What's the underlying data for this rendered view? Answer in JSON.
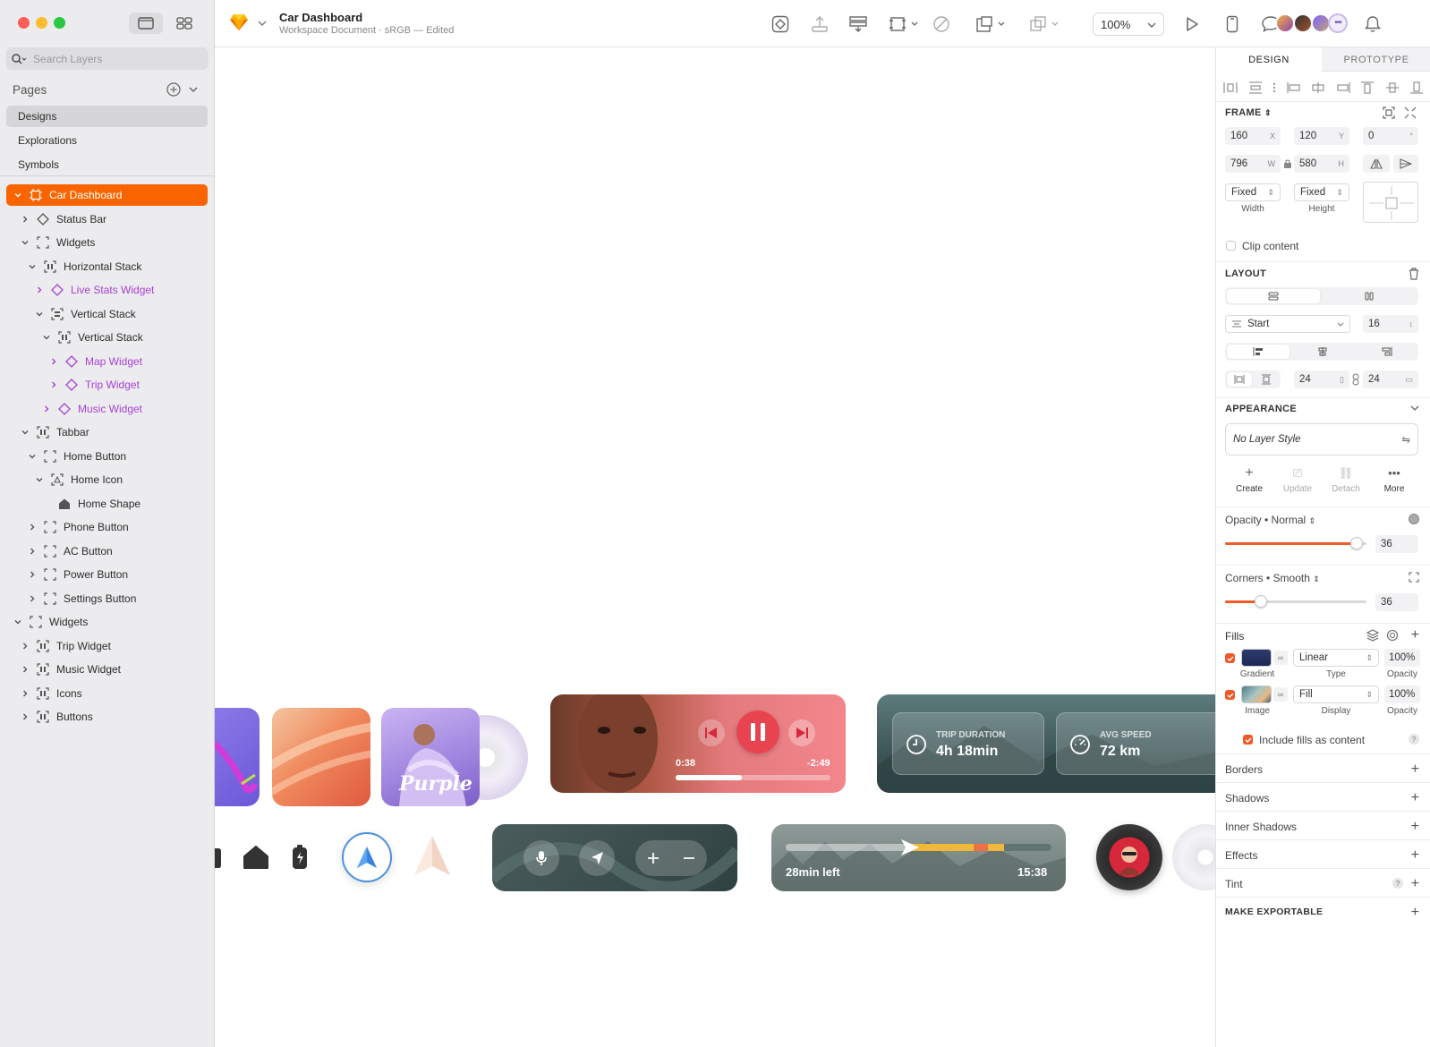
{
  "app": {
    "document_title": "Car Dashboard",
    "document_subtitle": "Workspace Document · sRGB — Edited",
    "zoom": "100%"
  },
  "sidebar": {
    "search_placeholder": "Search Layers",
    "pages_title": "Pages",
    "pages": [
      "Designs",
      "Explorations",
      "Symbols"
    ],
    "selected_page": "Designs",
    "layers": [
      {
        "label": "Car Dashboard",
        "depth": 0,
        "chevron": "down",
        "icon": "frame",
        "selected": true,
        "component": false
      },
      {
        "label": "Status Bar",
        "depth": 1,
        "chevron": "right",
        "icon": "component",
        "selected": false,
        "component": false
      },
      {
        "label": "Widgets",
        "depth": 1,
        "chevron": "down",
        "icon": "group",
        "selected": false,
        "component": false
      },
      {
        "label": "Horizontal Stack",
        "depth": 2,
        "chevron": "down",
        "icon": "stack",
        "selected": false,
        "component": false
      },
      {
        "label": "Live Stats Widget",
        "depth": 3,
        "chevron": "right",
        "icon": "component",
        "selected": false,
        "component": true
      },
      {
        "label": "Vertical Stack",
        "depth": 3,
        "chevron": "down",
        "icon": "vstack",
        "selected": false,
        "component": false
      },
      {
        "label": "Vertical Stack",
        "depth": 4,
        "chevron": "down",
        "icon": "stack",
        "selected": false,
        "component": false
      },
      {
        "label": "Map Widget",
        "depth": 5,
        "chevron": "right",
        "icon": "component",
        "selected": false,
        "component": true
      },
      {
        "label": "Trip Widget",
        "depth": 5,
        "chevron": "right",
        "icon": "component",
        "selected": false,
        "component": true
      },
      {
        "label": "Music Widget",
        "depth": 4,
        "chevron": "right",
        "icon": "component",
        "selected": false,
        "component": true
      },
      {
        "label": "Tabbar",
        "depth": 1,
        "chevron": "down",
        "icon": "stack",
        "selected": false,
        "component": false
      },
      {
        "label": "Home Button",
        "depth": 2,
        "chevron": "down",
        "icon": "group",
        "selected": false,
        "component": false
      },
      {
        "label": "Home Icon",
        "depth": 3,
        "chevron": "down",
        "icon": "shape-group",
        "selected": false,
        "component": false
      },
      {
        "label": "Home Shape",
        "depth": 4,
        "chevron": "none",
        "icon": "home",
        "selected": false,
        "component": false
      },
      {
        "label": "Phone Button",
        "depth": 2,
        "chevron": "right",
        "icon": "group",
        "selected": false,
        "component": false
      },
      {
        "label": "AC Button",
        "depth": 2,
        "chevron": "right",
        "icon": "group",
        "selected": false,
        "component": false
      },
      {
        "label": "Power Button",
        "depth": 2,
        "chevron": "right",
        "icon": "group",
        "selected": false,
        "component": false
      },
      {
        "label": "Settings Button",
        "depth": 2,
        "chevron": "right",
        "icon": "group",
        "selected": false,
        "component": false
      },
      {
        "label": "Widgets",
        "depth": 0,
        "chevron": "down",
        "icon": "group",
        "selected": false,
        "component": false
      },
      {
        "label": "Trip Widget",
        "depth": 1,
        "chevron": "right",
        "icon": "stack",
        "selected": false,
        "component": false
      },
      {
        "label": "Music Widget",
        "depth": 1,
        "chevron": "right",
        "icon": "stack",
        "selected": false,
        "component": false
      },
      {
        "label": "Icons",
        "depth": 1,
        "chevron": "right",
        "icon": "stack",
        "selected": false,
        "component": false
      },
      {
        "label": "Buttons",
        "depth": 1,
        "chevron": "right",
        "icon": "stack",
        "selected": false,
        "component": false
      }
    ]
  },
  "inspector": {
    "tabs": [
      "DESIGN",
      "PROTOTYPE"
    ],
    "active_tab": "DESIGN",
    "frame": {
      "title": "FRAME",
      "x": "160",
      "x_sfx": "X",
      "y": "120",
      "y_sfx": "Y",
      "rotation": "0",
      "rotation_sfx": "°",
      "w": "796",
      "w_sfx": "W",
      "h": "580",
      "h_sfx": "H",
      "width_mode": "Fixed",
      "height_mode": "Fixed",
      "width_label": "Width",
      "height_label": "Height",
      "clip_label": "Clip content"
    },
    "layout": {
      "title": "LAYOUT",
      "alignment": "Start",
      "spacing": "16",
      "padding_h": "24",
      "padding_v": "24"
    },
    "appearance": {
      "title": "APPEARANCE",
      "layer_style": "No Layer Style",
      "actions": [
        "Create",
        "Update",
        "Detach",
        "More"
      ],
      "opacity_label": "Opacity • Normal",
      "opacity_value": "36",
      "opacity_level": 0.93,
      "corners_label": "Corners • Smooth",
      "corners_value": "36",
      "corners_level": 0.25
    },
    "fills": {
      "title": "Fills",
      "rows": [
        {
          "swatch_label": "Gradient",
          "type": "Linear",
          "type_label": "Type",
          "opacity": "100%",
          "opacity_label": "Opacity"
        },
        {
          "swatch_label": "Image",
          "type": "Fill",
          "type_label": "Display",
          "opacity": "100%",
          "opacity_label": "Opacity"
        }
      ],
      "include_label": "Include fills as content"
    },
    "sections": [
      "Borders",
      "Shadows",
      "Inner Shadows",
      "Effects",
      "Tint"
    ],
    "exportable": "MAKE EXPORTABLE"
  },
  "canvas": {
    "music_player": {
      "elapsed": "0:38",
      "remaining": "-2:49",
      "progress": 0.43
    },
    "album_text": "Purple",
    "trip_duration_label": "TRIP DURATION",
    "trip_duration_value": "4h 18min",
    "avg_speed_label": "AVG SPEED",
    "avg_speed_value": "72 km",
    "route_left": "28min left",
    "route_time": "15:38"
  },
  "colors": {
    "accent": "#fa6400",
    "component": "#a740d8",
    "slider": "#f05a28"
  }
}
